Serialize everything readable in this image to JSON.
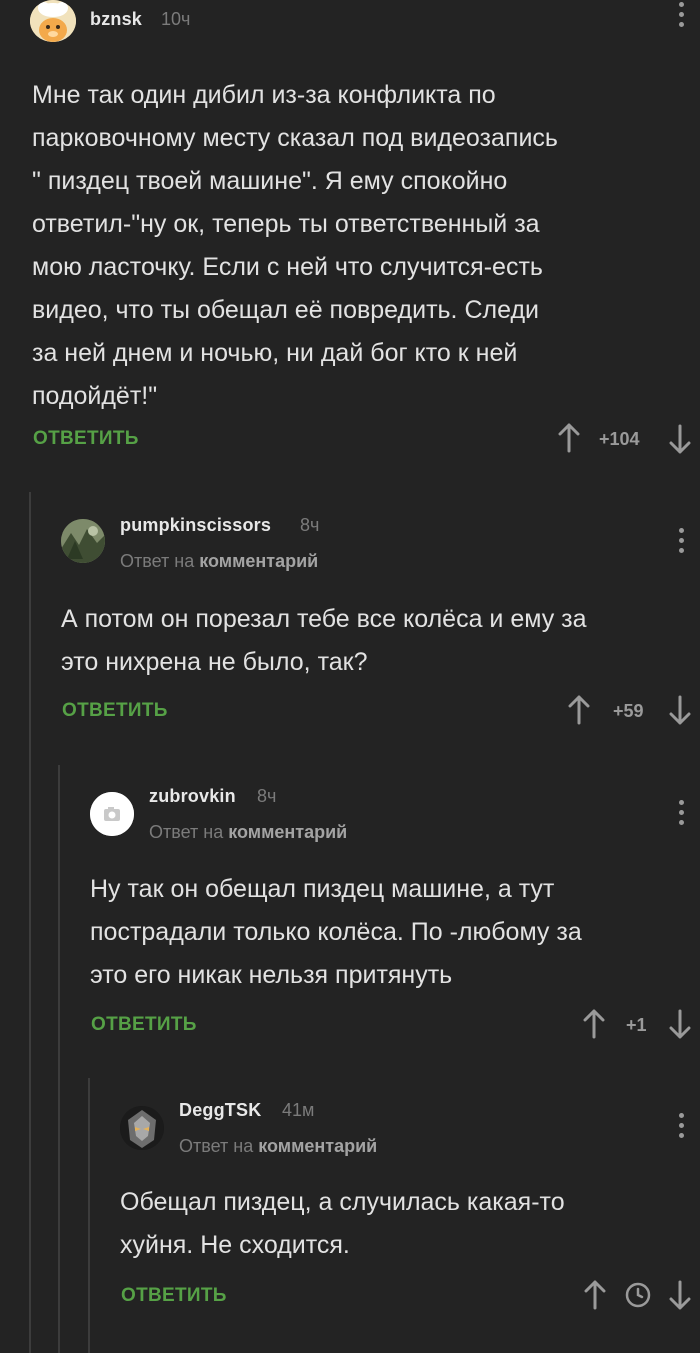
{
  "comments": [
    {
      "author": "bznsk",
      "time": "10ч",
      "text": "Мне так один дибил из-за конфликта по\nпарковочному месту сказал под видеозапись\n\"  пиздец твоей машине\". Я ему спокойно\nответил-\"ну ок, теперь ты ответственный за\nмою ласточку. Если с ней что случится-есть\nвидео, что ты обещал её повредить. Следи\nза ней днем и ночью, ни дай бог кто к ней\nподойдёт!\"",
      "reply_label": "ОТВЕТИТЬ",
      "rating": "+104"
    },
    {
      "author": "pumpkinscissors",
      "time": "8ч",
      "reply_to_prefix": "Ответ на",
      "reply_to_link": "комментарий",
      "text": "А потом он порезал тебе все колёса и ему за\nэто нихрена не было, так?",
      "reply_label": "ОТВЕТИТЬ",
      "rating": "+59"
    },
    {
      "author": "zubrovkin",
      "time": "8ч",
      "reply_to_prefix": "Ответ на",
      "reply_to_link": "комментарий",
      "text": "Ну так он обещал пиздец машине, а тут\nпострадали только колёса. По -любому за\nэто его никак нельзя притянуть",
      "reply_label": "ОТВЕТИТЬ",
      "rating": "+1"
    },
    {
      "author": "DeggTSK",
      "time": "41м",
      "reply_to_prefix": "Ответ на",
      "reply_to_link": "комментарий",
      "text": "Обещал пиздец, а случилась какая-то\nхуйня. Не сходится.",
      "reply_label": "ОТВЕТИТЬ",
      "rating_icon": "clock-icon"
    }
  ],
  "icons": {
    "upvote": "arrow-up-icon",
    "downvote": "arrow-down-icon",
    "menu": "more-vertical-icon",
    "pending_rating": "clock-icon",
    "camera": "camera-icon"
  },
  "colors": {
    "background": "#232323",
    "accent_green": "#56a146",
    "thread_line": "#3c3c3c"
  }
}
